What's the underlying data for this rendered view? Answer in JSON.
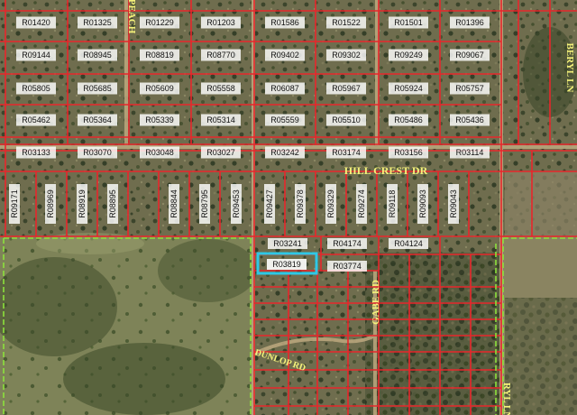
{
  "map": {
    "road_labels": {
      "hillcrest": "HILL CREST DR",
      "gabe": "GABE RD",
      "dunlop": "DUNLOP RD",
      "beryl_top": "BERYL LN",
      "beryl_bottom": "RYL LN",
      "peach": "PEACH"
    },
    "parcels": {
      "r01": [
        "R01420",
        "R01325",
        "R01229",
        "R01203",
        "R01586",
        "R01522",
        "R01501",
        "R01396"
      ],
      "r02": [
        "R09144",
        "R08945",
        "R08819",
        "R08770",
        "R09402",
        "R09302",
        "R09249",
        "R09067"
      ],
      "r03": [
        "R05805",
        "R05685",
        "R05609",
        "R05558",
        "R06087",
        "R05967",
        "R05924",
        "R05757"
      ],
      "r04": [
        "R05462",
        "R05364",
        "R05339",
        "R05314",
        "R05559",
        "R05510",
        "R05486",
        "R05436"
      ],
      "r05": [
        "R03133",
        "R03070",
        "R03048",
        "R03027",
        "R03242",
        "R03174",
        "R03156",
        "R03114"
      ],
      "vertical": [
        "R09171",
        "R08969",
        "R08919",
        "R08895",
        "R08844",
        "R08795",
        "R09453",
        "R09427",
        "R09378",
        "R09329",
        "R09274",
        "R09118",
        "R09093",
        "R09043"
      ],
      "south": [
        "R03241",
        "R04174",
        "R04124",
        "R03819",
        "R03774"
      ],
      "highlighted": "R03819"
    },
    "colors": {
      "lot_lines": "#e8262b",
      "subject_lot": "#2ec8e6",
      "boundary": "#8ce13c",
      "road_label": "#f4f27a"
    }
  }
}
